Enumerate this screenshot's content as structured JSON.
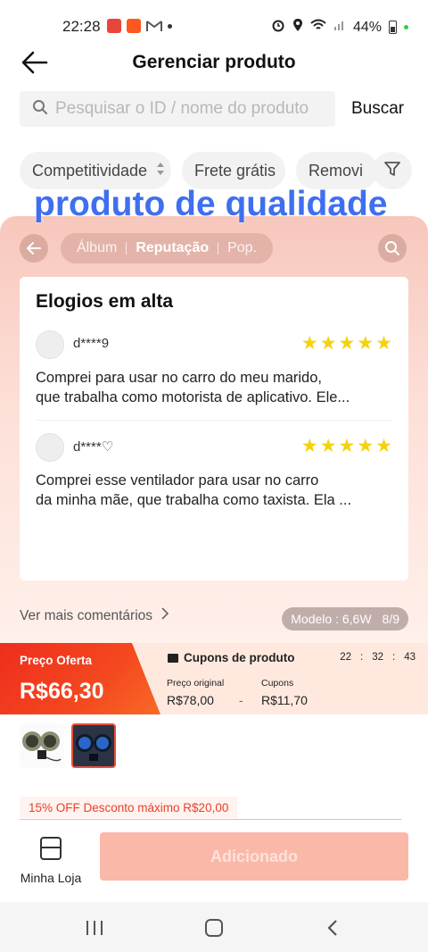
{
  "status": {
    "time": "22:28",
    "battery": "44%",
    "icons_left": [
      "photos-icon",
      "video-icon",
      "gmail-icon",
      "dot-icon"
    ],
    "icons_right": [
      "alarm-icon",
      "location-icon",
      "wifi-icon",
      "signal-icon",
      "battery-icon"
    ]
  },
  "header": {
    "title": "Gerenciar produto"
  },
  "search": {
    "placeholder": "Pesquisar o ID / nome do produto",
    "button_label": "Buscar"
  },
  "filters": {
    "chips": [
      "Competitividade",
      "Frete grátis",
      "Removi"
    ],
    "filter_icon": "funnel-icon"
  },
  "overlay": {
    "title": "produto de qualidade"
  },
  "panel": {
    "tabs": [
      "Álbum",
      "Reputação",
      "Pop."
    ],
    "active_tab": "Reputação"
  },
  "reviews": {
    "heading": "Elogios em alta",
    "items": [
      {
        "user": "d****9",
        "rating": 5,
        "line1": "Comprei para usar no carro do meu marido,",
        "line2": "que trabalha como motorista de aplicativo. Ele..."
      },
      {
        "user": "d****♡",
        "rating": 5,
        "line1": "Comprei esse ventilador para usar no carro",
        "line2": "da minha mãe, que trabalha como taxista. Ela ..."
      }
    ],
    "more_link": "Ver mais comentários",
    "model_label": "Modelo : 6,6W",
    "model_index": "8/9"
  },
  "price": {
    "offer_label": "Preço Oferta",
    "offer_value": "R$66,30",
    "coupons_title": "Cupons de produto",
    "countdown": [
      "22",
      "32",
      "43"
    ],
    "countdown_sep": ":",
    "original_label": "Preço original",
    "original_value": "R$78,00",
    "minus": "-",
    "coupon_label": "Cupons",
    "coupon_value": "R$11,70"
  },
  "discount": {
    "text": "15% OFF Desconto máximo R$20,00"
  },
  "bottom": {
    "store_label": "Minha Loja",
    "add_label": "Adicionado"
  },
  "colors": {
    "accent_red": "#ee2d1d",
    "overlay_blue": "#3f6ff0",
    "stars": "#f5d20b",
    "add_button": "#fab8a9"
  }
}
